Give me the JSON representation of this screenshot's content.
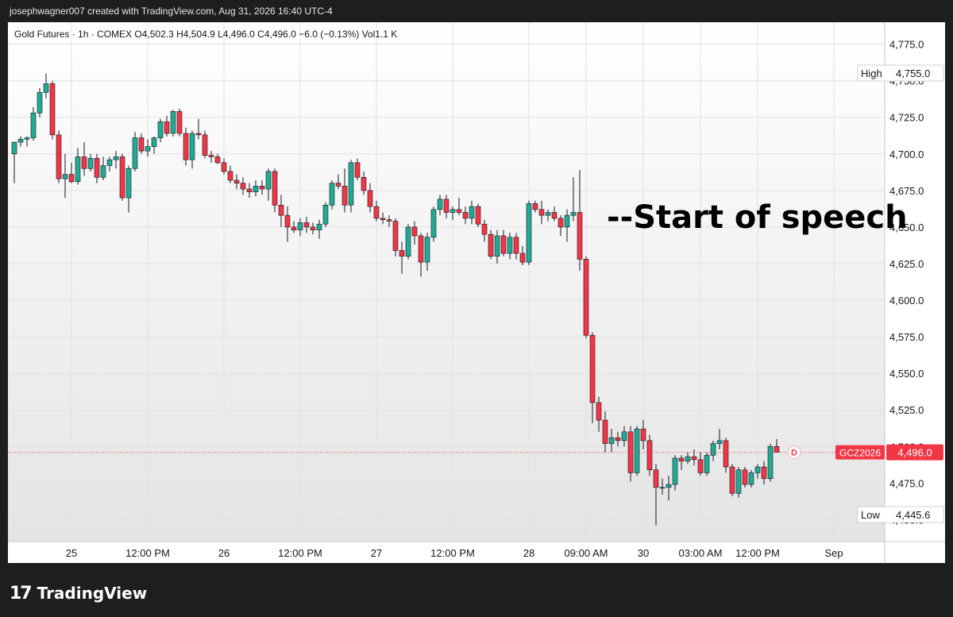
{
  "header": {
    "attribution": "josephwagner007 created with TradingView.com, Aug 31, 2026 16:40 UTC-4"
  },
  "legend": {
    "text": "Gold Futures · 1h · COMEX  O4,502.3  H4,504.9  L4,496.0  C4,496.0  −6.0 (−0.13%)  Vol1.1 K"
  },
  "brand": {
    "text": "TradingView"
  },
  "annotation": {
    "text": "--Start of speech"
  },
  "colors": {
    "up": "#22ab94",
    "down": "#f23645",
    "price_tag": "#f23645",
    "annotation": "#000000"
  },
  "chart_data": {
    "type": "candlestick",
    "title": "Gold Futures · 1h · COMEX",
    "symbol": "GCZ2026",
    "last_price": 4496.0,
    "last_price_label": "4,496.0",
    "high_label": "High",
    "high_value": "4,755.0",
    "low_label": "Low",
    "low_value": "4,445.6",
    "ylim": [
      4435,
      4790
    ],
    "y_ticks": [
      4450,
      4475,
      4500,
      4525,
      4550,
      4575,
      4600,
      4625,
      4650,
      4675,
      4700,
      4725,
      4750,
      4775
    ],
    "y_tick_labels": [
      "4,450.0",
      "4,475.0",
      "4,500.0",
      "4,525.0",
      "4,550.0",
      "4,575.0",
      "4,600.0",
      "4,625.0",
      "4,650.0",
      "4,675.0",
      "4,700.0",
      "4,725.0",
      "4,750.0",
      "4,775.0"
    ],
    "x_ticks": [
      {
        "label": "25",
        "index": 9
      },
      {
        "label": "12:00 PM",
        "index": 21
      },
      {
        "label": "26",
        "index": 33
      },
      {
        "label": "12:00 PM",
        "index": 45
      },
      {
        "label": "27",
        "index": 57
      },
      {
        "label": "12:00 PM",
        "index": 69
      },
      {
        "label": "28",
        "index": 81
      },
      {
        "label": "09:00 AM",
        "index": 90
      },
      {
        "label": "30",
        "index": 99
      },
      {
        "label": "03:00 AM",
        "index": 108
      },
      {
        "label": "12:00 PM",
        "index": 117
      },
      {
        "label": "Sep",
        "index": 129
      }
    ],
    "annotation_index": 92,
    "candles": [
      {
        "o": 4700,
        "h": 4708,
        "l": 4680,
        "c": 4708
      },
      {
        "o": 4708,
        "h": 4712,
        "l": 4705,
        "c": 4710
      },
      {
        "o": 4710,
        "h": 4712,
        "l": 4705,
        "c": 4711
      },
      {
        "o": 4711,
        "h": 4732,
        "l": 4709,
        "c": 4728
      },
      {
        "o": 4728,
        "h": 4745,
        "l": 4725,
        "c": 4742
      },
      {
        "o": 4742,
        "h": 4755,
        "l": 4738,
        "c": 4748
      },
      {
        "o": 4748,
        "h": 4750,
        "l": 4710,
        "c": 4713
      },
      {
        "o": 4713,
        "h": 4716,
        "l": 4680,
        "c": 4683
      },
      {
        "o": 4683,
        "h": 4700,
        "l": 4670,
        "c": 4686
      },
      {
        "o": 4686,
        "h": 4694,
        "l": 4680,
        "c": 4681
      },
      {
        "o": 4681,
        "h": 4704,
        "l": 4679,
        "c": 4698
      },
      {
        "o": 4698,
        "h": 4708,
        "l": 4685,
        "c": 4690
      },
      {
        "o": 4690,
        "h": 4700,
        "l": 4688,
        "c": 4697
      },
      {
        "o": 4697,
        "h": 4700,
        "l": 4680,
        "c": 4684
      },
      {
        "o": 4684,
        "h": 4698,
        "l": 4682,
        "c": 4692
      },
      {
        "o": 4692,
        "h": 4698,
        "l": 4688,
        "c": 4696
      },
      {
        "o": 4696,
        "h": 4702,
        "l": 4690,
        "c": 4698
      },
      {
        "o": 4698,
        "h": 4700,
        "l": 4668,
        "c": 4670
      },
      {
        "o": 4670,
        "h": 4692,
        "l": 4660,
        "c": 4690
      },
      {
        "o": 4690,
        "h": 4715,
        "l": 4688,
        "c": 4711
      },
      {
        "o": 4711,
        "h": 4714,
        "l": 4700,
        "c": 4702
      },
      {
        "o": 4702,
        "h": 4710,
        "l": 4698,
        "c": 4705
      },
      {
        "o": 4705,
        "h": 4712,
        "l": 4700,
        "c": 4711
      },
      {
        "o": 4711,
        "h": 4724,
        "l": 4708,
        "c": 4722
      },
      {
        "o": 4722,
        "h": 4726,
        "l": 4712,
        "c": 4714
      },
      {
        "o": 4714,
        "h": 4730,
        "l": 4712,
        "c": 4729
      },
      {
        "o": 4729,
        "h": 4731,
        "l": 4712,
        "c": 4714
      },
      {
        "o": 4714,
        "h": 4718,
        "l": 4692,
        "c": 4696
      },
      {
        "o": 4696,
        "h": 4716,
        "l": 4690,
        "c": 4714
      },
      {
        "o": 4714,
        "h": 4724,
        "l": 4710,
        "c": 4713
      },
      {
        "o": 4713,
        "h": 4716,
        "l": 4697,
        "c": 4699
      },
      {
        "o": 4699,
        "h": 4702,
        "l": 4694,
        "c": 4698
      },
      {
        "o": 4698,
        "h": 4700,
        "l": 4693,
        "c": 4694
      },
      {
        "o": 4694,
        "h": 4697,
        "l": 4686,
        "c": 4688
      },
      {
        "o": 4688,
        "h": 4692,
        "l": 4680,
        "c": 4682
      },
      {
        "o": 4682,
        "h": 4686,
        "l": 4676,
        "c": 4680
      },
      {
        "o": 4680,
        "h": 4684,
        "l": 4672,
        "c": 4676
      },
      {
        "o": 4676,
        "h": 4680,
        "l": 4670,
        "c": 4674
      },
      {
        "o": 4674,
        "h": 4682,
        "l": 4671,
        "c": 4678
      },
      {
        "o": 4678,
        "h": 4682,
        "l": 4672,
        "c": 4676
      },
      {
        "o": 4676,
        "h": 4690,
        "l": 4668,
        "c": 4688
      },
      {
        "o": 4688,
        "h": 4690,
        "l": 4660,
        "c": 4665
      },
      {
        "o": 4665,
        "h": 4672,
        "l": 4650,
        "c": 4658
      },
      {
        "o": 4658,
        "h": 4664,
        "l": 4640,
        "c": 4650
      },
      {
        "o": 4650,
        "h": 4654,
        "l": 4646,
        "c": 4648
      },
      {
        "o": 4648,
        "h": 4656,
        "l": 4644,
        "c": 4653
      },
      {
        "o": 4653,
        "h": 4657,
        "l": 4646,
        "c": 4650
      },
      {
        "o": 4650,
        "h": 4653,
        "l": 4645,
        "c": 4648
      },
      {
        "o": 4648,
        "h": 4655,
        "l": 4642,
        "c": 4652
      },
      {
        "o": 4652,
        "h": 4667,
        "l": 4650,
        "c": 4665
      },
      {
        "o": 4665,
        "h": 4682,
        "l": 4662,
        "c": 4680
      },
      {
        "o": 4680,
        "h": 4686,
        "l": 4676,
        "c": 4678
      },
      {
        "o": 4678,
        "h": 4690,
        "l": 4660,
        "c": 4665
      },
      {
        "o": 4665,
        "h": 4696,
        "l": 4660,
        "c": 4694
      },
      {
        "o": 4694,
        "h": 4697,
        "l": 4682,
        "c": 4684
      },
      {
        "o": 4684,
        "h": 4688,
        "l": 4672,
        "c": 4675
      },
      {
        "o": 4675,
        "h": 4680,
        "l": 4660,
        "c": 4664
      },
      {
        "o": 4664,
        "h": 4668,
        "l": 4654,
        "c": 4656
      },
      {
        "o": 4656,
        "h": 4660,
        "l": 4652,
        "c": 4655
      },
      {
        "o": 4655,
        "h": 4658,
        "l": 4650,
        "c": 4654
      },
      {
        "o": 4654,
        "h": 4656,
        "l": 4630,
        "c": 4634
      },
      {
        "o": 4634,
        "h": 4640,
        "l": 4618,
        "c": 4630
      },
      {
        "o": 4630,
        "h": 4652,
        "l": 4628,
        "c": 4650
      },
      {
        "o": 4650,
        "h": 4654,
        "l": 4638,
        "c": 4644
      },
      {
        "o": 4644,
        "h": 4646,
        "l": 4616,
        "c": 4626
      },
      {
        "o": 4626,
        "h": 4646,
        "l": 4620,
        "c": 4643
      },
      {
        "o": 4643,
        "h": 4664,
        "l": 4640,
        "c": 4662
      },
      {
        "o": 4662,
        "h": 4672,
        "l": 4658,
        "c": 4669
      },
      {
        "o": 4669,
        "h": 4672,
        "l": 4656,
        "c": 4660
      },
      {
        "o": 4660,
        "h": 4664,
        "l": 4655,
        "c": 4662
      },
      {
        "o": 4662,
        "h": 4670,
        "l": 4658,
        "c": 4660
      },
      {
        "o": 4660,
        "h": 4664,
        "l": 4652,
        "c": 4656
      },
      {
        "o": 4656,
        "h": 4668,
        "l": 4652,
        "c": 4664
      },
      {
        "o": 4664,
        "h": 4666,
        "l": 4650,
        "c": 4652
      },
      {
        "o": 4652,
        "h": 4655,
        "l": 4640,
        "c": 4645
      },
      {
        "o": 4645,
        "h": 4648,
        "l": 4628,
        "c": 4630
      },
      {
        "o": 4630,
        "h": 4648,
        "l": 4625,
        "c": 4644
      },
      {
        "o": 4644,
        "h": 4648,
        "l": 4630,
        "c": 4632
      },
      {
        "o": 4632,
        "h": 4646,
        "l": 4628,
        "c": 4643
      },
      {
        "o": 4643,
        "h": 4646,
        "l": 4628,
        "c": 4632
      },
      {
        "o": 4632,
        "h": 4637,
        "l": 4624,
        "c": 4626
      },
      {
        "o": 4626,
        "h": 4668,
        "l": 4624,
        "c": 4666
      },
      {
        "o": 4666,
        "h": 4668,
        "l": 4660,
        "c": 4662
      },
      {
        "o": 4662,
        "h": 4668,
        "l": 4652,
        "c": 4658
      },
      {
        "o": 4658,
        "h": 4662,
        "l": 4654,
        "c": 4660
      },
      {
        "o": 4660,
        "h": 4664,
        "l": 4654,
        "c": 4656
      },
      {
        "o": 4656,
        "h": 4658,
        "l": 4644,
        "c": 4650
      },
      {
        "o": 4650,
        "h": 4662,
        "l": 4640,
        "c": 4658
      },
      {
        "o": 4658,
        "h": 4684,
        "l": 4654,
        "c": 4660
      },
      {
        "o": 4660,
        "h": 4689,
        "l": 4620,
        "c": 4628
      },
      {
        "o": 4628,
        "h": 4630,
        "l": 4574,
        "c": 4576
      },
      {
        "o": 4576,
        "h": 4578,
        "l": 4516,
        "c": 4530
      },
      {
        "o": 4530,
        "h": 4534,
        "l": 4510,
        "c": 4518
      },
      {
        "o": 4518,
        "h": 4524,
        "l": 4496,
        "c": 4502
      },
      {
        "o": 4502,
        "h": 4512,
        "l": 4496,
        "c": 4506
      },
      {
        "o": 4506,
        "h": 4510,
        "l": 4500,
        "c": 4504
      },
      {
        "o": 4504,
        "h": 4514,
        "l": 4500,
        "c": 4510
      },
      {
        "o": 4510,
        "h": 4514,
        "l": 4476,
        "c": 4482
      },
      {
        "o": 4482,
        "h": 4514,
        "l": 4480,
        "c": 4512
      },
      {
        "o": 4512,
        "h": 4518,
        "l": 4498,
        "c": 4504
      },
      {
        "o": 4504,
        "h": 4508,
        "l": 4480,
        "c": 4484
      },
      {
        "o": 4484,
        "h": 4488,
        "l": 4446,
        "c": 4472
      },
      {
        "o": 4472,
        "h": 4478,
        "l": 4467,
        "c": 4472
      },
      {
        "o": 4472,
        "h": 4480,
        "l": 4463,
        "c": 4474
      },
      {
        "o": 4474,
        "h": 4494,
        "l": 4470,
        "c": 4492
      },
      {
        "o": 4492,
        "h": 4494,
        "l": 4484,
        "c": 4490
      },
      {
        "o": 4490,
        "h": 4496,
        "l": 4488,
        "c": 4493
      },
      {
        "o": 4493,
        "h": 4498,
        "l": 4487,
        "c": 4491
      },
      {
        "o": 4491,
        "h": 4496,
        "l": 4480,
        "c": 4482
      },
      {
        "o": 4482,
        "h": 4496,
        "l": 4480,
        "c": 4494
      },
      {
        "o": 4494,
        "h": 4504,
        "l": 4490,
        "c": 4502
      },
      {
        "o": 4502,
        "h": 4512,
        "l": 4498,
        "c": 4504
      },
      {
        "o": 4504,
        "h": 4506,
        "l": 4482,
        "c": 4486
      },
      {
        "o": 4486,
        "h": 4488,
        "l": 4466,
        "c": 4468
      },
      {
        "o": 4468,
        "h": 4486,
        "l": 4465,
        "c": 4484
      },
      {
        "o": 4484,
        "h": 4486,
        "l": 4472,
        "c": 4474
      },
      {
        "o": 4474,
        "h": 4484,
        "l": 4472,
        "c": 4482
      },
      {
        "o": 4482,
        "h": 4488,
        "l": 4478,
        "c": 4486
      },
      {
        "o": 4486,
        "h": 4490,
        "l": 4474,
        "c": 4478
      },
      {
        "o": 4478,
        "h": 4502,
        "l": 4476,
        "c": 4500
      },
      {
        "o": 4500,
        "h": 4505,
        "l": 4496,
        "c": 4496
      }
    ]
  }
}
